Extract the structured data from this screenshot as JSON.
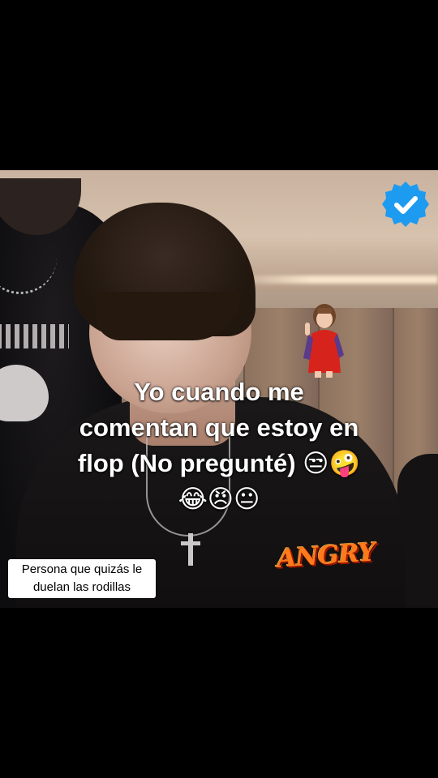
{
  "caption": {
    "line1": "Yo cuando me",
    "line2": "comentan que estoy en",
    "line3": "flop (No pregunté) 😒🤪",
    "line4": "😂😠😐"
  },
  "note_label": {
    "line1": "Persona que quizás le",
    "line2": "duelan las rodillas"
  },
  "stickers": {
    "angry_text": "ANGRY",
    "verified_icon": "verified-check-icon",
    "girl_icon": "waving-girl-sticker"
  },
  "colors": {
    "verified_blue": "#1D9BF0",
    "angry_orange": "#FF7A1A",
    "letterbox": "#000000"
  }
}
